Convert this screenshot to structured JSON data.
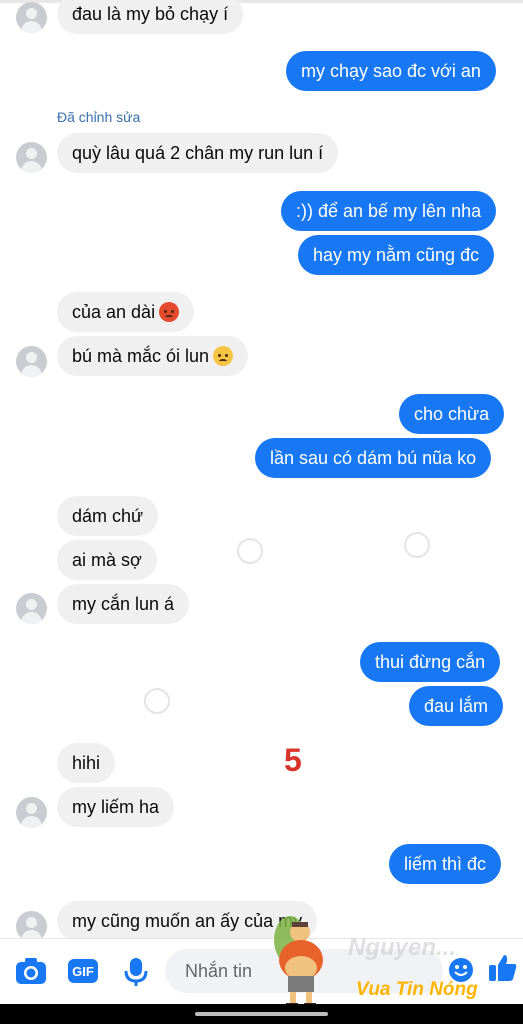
{
  "edited_label": "Đã chỉnh sửa",
  "messages": [
    {
      "from": "them",
      "text": "đau là my bỏ chạy í"
    },
    {
      "from": "me",
      "text": "my chạy sao đc với an"
    },
    {
      "from": "them",
      "text": "quỳ lâu quá 2 chân my run lun í"
    },
    {
      "from": "me",
      "text": ":)) để an bế my lên nha"
    },
    {
      "from": "me",
      "text": "hay my nằm cũng đc"
    },
    {
      "from": "them",
      "text": "của an dài"
    },
    {
      "from": "them",
      "text": "bú mà mắc ói lun"
    },
    {
      "from": "me",
      "text": "cho chừa"
    },
    {
      "from": "me",
      "text": "lần sau có dám bú nũa ko"
    },
    {
      "from": "them",
      "text": "dám chứ"
    },
    {
      "from": "them",
      "text": "ai mà sợ"
    },
    {
      "from": "them",
      "text": "my cắn lun á"
    },
    {
      "from": "me",
      "text": "thui đừng cắn"
    },
    {
      "from": "me",
      "text": "đau lắm"
    },
    {
      "from": "them",
      "text": "hihi"
    },
    {
      "from": "them",
      "text": "my liếm ha"
    },
    {
      "from": "me",
      "text": "liếm thì đc"
    },
    {
      "from": "them",
      "text": "my cũng muốn an ấy của my"
    }
  ],
  "overlay_number": "5",
  "composer": {
    "placeholder": "Nhắn tin"
  },
  "watermark": {
    "brand": "Vua Tin Nóng",
    "faded": "Nguyen..."
  },
  "colors": {
    "outgoing": "#1877f2",
    "incoming": "#f0f0f0",
    "accent": "#1877f2"
  },
  "icons": [
    "camera-icon",
    "gif-icon",
    "microphone-icon",
    "emoji-icon",
    "like-icon"
  ]
}
